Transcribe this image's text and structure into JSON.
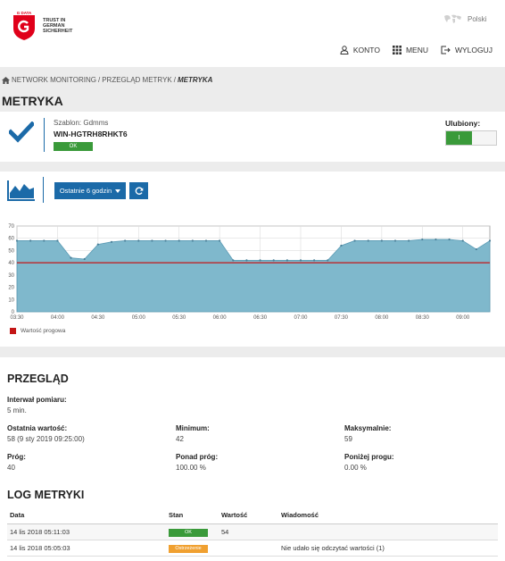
{
  "header": {
    "logo_brand": "G DATA",
    "logo_tagline_1": "TRUST IN",
    "logo_tagline_2": "GERMAN",
    "logo_tagline_3": "SICHERHEIT",
    "language": "Polski",
    "nav": {
      "account": "KONTO",
      "menu": "MENU",
      "logout": "WYLOGUJ"
    }
  },
  "breadcrumb": {
    "item1": "NETWORK MONITORING",
    "sep": "/",
    "item2": "PRZEGLĄD METRYK",
    "current": "METRYKA"
  },
  "page_title": "METRYKA",
  "metric": {
    "template": "Szablon: Gdmms",
    "host": "WIN-HGTRH8RHKT6",
    "status": "OK",
    "favorite_label": "Ulubiony:",
    "favorite_toggle": "I"
  },
  "chart_controls": {
    "range_label": "Ostatnie 6 godzin"
  },
  "colors": {
    "accent": "#1b6aa8",
    "ok": "#3a9a3a",
    "warning": "#f0a030",
    "threshold": "#c41616",
    "area": "#7fb8cc"
  },
  "chart_data": {
    "type": "area",
    "x": [
      "03:30",
      "03:40",
      "03:50",
      "04:00",
      "04:10",
      "04:20",
      "04:30",
      "04:40",
      "04:50",
      "05:00",
      "05:10",
      "05:20",
      "05:30",
      "05:40",
      "05:50",
      "06:00",
      "06:10",
      "06:20",
      "06:30",
      "06:40",
      "06:50",
      "07:00",
      "07:10",
      "07:20",
      "07:30",
      "07:40",
      "07:50",
      "08:00",
      "08:10",
      "08:20",
      "08:30",
      "08:40",
      "08:50",
      "09:00",
      "09:10",
      "09:20"
    ],
    "series": [
      {
        "values": [
          58,
          58,
          58,
          58,
          44,
          43,
          55,
          57,
          58,
          58,
          58,
          58,
          58,
          58,
          58,
          58,
          42,
          42,
          42,
          42,
          42,
          42,
          42,
          42,
          54,
          58,
          58,
          58,
          58,
          58,
          59,
          59,
          59,
          58,
          51,
          58
        ]
      }
    ],
    "threshold": 40,
    "ylim": [
      0,
      70
    ],
    "y_ticks": [
      0,
      10,
      20,
      30,
      40,
      50,
      60,
      70
    ],
    "x_ticks": [
      "03:30",
      "04:00",
      "04:30",
      "05:00",
      "05:30",
      "06:00",
      "06:30",
      "07:00",
      "07:30",
      "08:00",
      "08:30",
      "09:00"
    ],
    "legend": [
      "Wartość progowa"
    ],
    "grid": true
  },
  "overview": {
    "title": "PRZEGLĄD",
    "interval_label": "Interwał pomiaru:",
    "interval_value": "5 min.",
    "last_label": "Ostatnia wartość:",
    "last_value": "58 (9 sty 2019 09:25:00)",
    "min_label": "Minimum:",
    "min_value": "42",
    "max_label": "Maksymalnie:",
    "max_value": "59",
    "threshold_label": "Próg:",
    "threshold_value": "40",
    "above_label": "Ponad próg:",
    "above_value": "100.00 %",
    "below_label": "Poniżej progu:",
    "below_value": "0.00 %"
  },
  "log": {
    "title": "LOG METRYKI",
    "headers": {
      "date": "Data",
      "state": "Stan",
      "value": "Wartość",
      "message": "Wiadomość"
    },
    "rows": [
      {
        "date": "14 lis 2018 05:11:03",
        "state": "OK",
        "value": "54",
        "message": ""
      },
      {
        "date": "14 lis 2018 05:05:03",
        "state": "Ostrzeżenie",
        "value": "",
        "message": "Nie udało się odczytać wartości (1)"
      }
    ]
  }
}
